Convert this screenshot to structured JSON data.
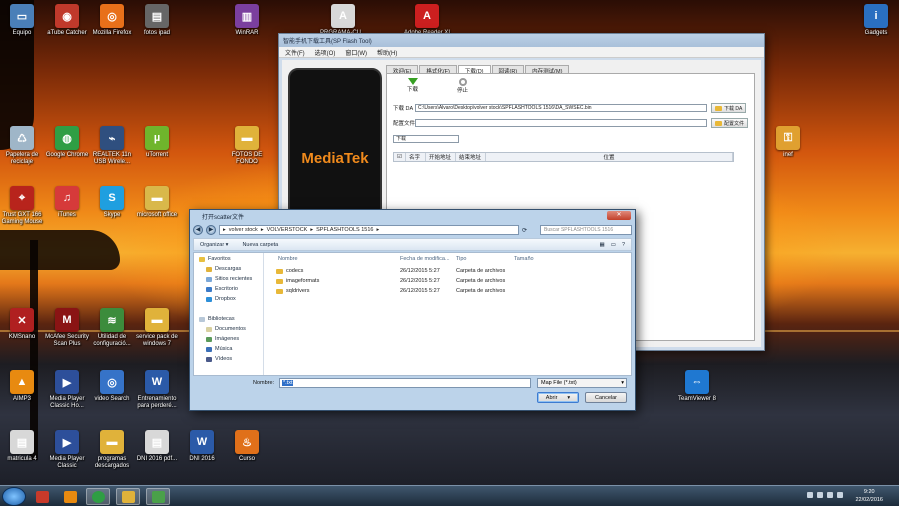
{
  "desktop": {
    "icons": [
      {
        "label": "Equipo",
        "icon": "computer-icon",
        "color": "#4a7fb8",
        "glyph": "▭"
      },
      {
        "label": "aTube Catcher",
        "icon": "atube-catcher-icon",
        "color": "#c0392b",
        "glyph": "◉"
      },
      {
        "label": "Mozilla Firefox",
        "icon": "firefox-icon",
        "color": "#e8701a",
        "glyph": "◎"
      },
      {
        "label": "fotos ipad",
        "icon": "folder-file-icon",
        "color": "#666666",
        "glyph": "▤"
      },
      {
        "label": "WinRAR",
        "icon": "winrar-icon",
        "color": "#7b3f9e",
        "glyph": "▥"
      },
      {
        "label": "PRGRAMA-CU...",
        "icon": "pdf-icon",
        "color": "#d8d8d8",
        "glyph": "A"
      },
      {
        "label": "Adobe Reader XI",
        "icon": "adobe-reader-icon",
        "color": "#cc1f1f",
        "glyph": "A"
      },
      {
        "label": "Papelera de\nreciclaje",
        "icon": "recycle-bin-icon",
        "color": "#9fb6c8",
        "glyph": "♺"
      },
      {
        "label": "Google Chrome",
        "icon": "chrome-icon",
        "color": "#2f9e44",
        "glyph": "◍"
      },
      {
        "label": "REALTEK 11n\nUSB Wirele...",
        "icon": "wireless-icon",
        "color": "#2f4f7f",
        "glyph": "⌁"
      },
      {
        "label": "uTorrent",
        "icon": "utorrent-icon",
        "color": "#6fb52c",
        "glyph": "µ"
      },
      {
        "label": "FOTOS DE\nFONDO",
        "icon": "folder-icon",
        "color": "#e0b23a",
        "glyph": "▬"
      },
      {
        "label": "Trust GXT 166\nGaming Mouse",
        "icon": "mouse-icon",
        "color": "#b8241c",
        "glyph": "⌖"
      },
      {
        "label": "iTunes",
        "icon": "itunes-icon",
        "color": "#d63a3a",
        "glyph": "♫"
      },
      {
        "label": "Skype",
        "icon": "skype-icon",
        "color": "#1f9fe0",
        "glyph": "S"
      },
      {
        "label": "microsoft office",
        "icon": "office-folder-icon",
        "color": "#d9b84a",
        "glyph": "▬"
      },
      {
        "label": "KMSnano",
        "icon": "kmsnano-icon",
        "color": "#b02020",
        "glyph": "✕"
      },
      {
        "label": "McAfee Security\nScan Plus",
        "icon": "mcafee-icon",
        "color": "#8a1414",
        "glyph": "M"
      },
      {
        "label": "Utilidad de\nconfiguració...",
        "icon": "config-utility-icon",
        "color": "#3c8c3c",
        "glyph": "≋"
      },
      {
        "label": "service pack de\nwindows 7",
        "icon": "service-pack-folder-icon",
        "color": "#e0b23a",
        "glyph": "▬"
      },
      {
        "label": "AIMP3",
        "icon": "aimp-icon",
        "color": "#e88a10",
        "glyph": "▲"
      },
      {
        "label": "Media Player\nClassic Ho...",
        "icon": "media-player-icon",
        "color": "#2d4f9a",
        "glyph": "▶"
      },
      {
        "label": "video Search",
        "icon": "video-search-icon",
        "color": "#3673c8",
        "glyph": "◎"
      },
      {
        "label": "Entrenamiento\npara perderé...",
        "icon": "word-doc-icon",
        "color": "#2b5aa8",
        "glyph": "W"
      },
      {
        "label": "matricula 4",
        "icon": "pdf-file-icon",
        "color": "#d8d8d8",
        "glyph": "▤"
      },
      {
        "label": "Media Player\nClassic",
        "icon": "media-player-classic-icon",
        "color": "#2d4f9a",
        "glyph": "▶"
      },
      {
        "label": "programas\ndescargados",
        "icon": "downloads-folder-icon",
        "color": "#e0b23a",
        "glyph": "▬"
      },
      {
        "label": "DNI 2016 pdf...",
        "icon": "pdf-doc-icon",
        "color": "#d8d8d8",
        "glyph": "▤"
      },
      {
        "label": "DNI 2016",
        "icon": "word-file-icon",
        "color": "#2b5aa8",
        "glyph": "W"
      },
      {
        "label": "Curso",
        "icon": "flame-icon",
        "color": "#e0701a",
        "glyph": "♨"
      },
      {
        "label": "Gadgets",
        "icon": "info-icon",
        "color": "#2a6fc0",
        "glyph": "i"
      },
      {
        "label": "inef",
        "icon": "key-icon",
        "color": "#e0a030",
        "glyph": "⚿"
      },
      {
        "label": "TeamViewer 8",
        "icon": "teamviewer-icon",
        "color": "#1f78d1",
        "glyph": "⇔"
      }
    ]
  },
  "flash_tool": {
    "title": "智能手机下载工具(SP Flash Tool)",
    "menu": [
      "文件(F)",
      "选项(O)",
      "窗口(W)",
      "帮助(H)"
    ],
    "tabs": [
      "欢迎(E)",
      "格式化(F)",
      "下载(D)",
      "回读(R)",
      "内存测试(M)"
    ],
    "active_tab": "下载(D)",
    "download_label": "下载",
    "stop_label": "停止",
    "da_label": "下载 DA",
    "da_path": "C:\\Users\\Alvaro\\Desktop\\volver stock\\SPFLASHTOOLS 1516\\DA_SWSEC.bin",
    "da_button": "下载 DA",
    "scatter_label": "配置文件",
    "scatter_path": "",
    "scatter_button": "配置文件",
    "mode": "下载",
    "grid_columns": [
      "名字",
      "开始地址",
      "结束地址",
      "位置"
    ],
    "phone_brand": "MediaTek"
  },
  "open_dialog": {
    "title": "打开scatter文件",
    "breadcrumb": [
      "volver stock",
      "VOLVERSTOCK",
      "SPFLASHTOOLS 1516"
    ],
    "search_placeholder": "Buscar SPFLASHTOOLS 1516",
    "organize": "Organizar ▾",
    "new_folder": "Nueva carpeta",
    "nav": {
      "favorites_header": "Favoritos",
      "favorites": [
        "Descargas",
        "Sitios recientes",
        "Escritorio",
        "Dropbox"
      ],
      "libraries_header": "Bibliotecas",
      "libraries": [
        "Documentos",
        "Imágenes",
        "Música",
        "Vídeos"
      ]
    },
    "columns": [
      "Nombre",
      "Fecha de modifica...",
      "Tipo",
      "Tamaño"
    ],
    "files": [
      {
        "name": "codecs",
        "date": "26/12/2015 5:27",
        "type": "Carpeta de archivos"
      },
      {
        "name": "imageformats",
        "date": "26/12/2015 5:27",
        "type": "Carpeta de archivos"
      },
      {
        "name": "sqldrivers",
        "date": "26/12/2015 5:27",
        "type": "Carpeta de archivos"
      }
    ],
    "filename_label": "Nombre:",
    "filename_value": "*.txt",
    "filter": "Map File (*.txt)",
    "open_button": "Abrir",
    "cancel_button": "Cancelar"
  },
  "taskbar": {
    "time": "9:20",
    "date": "22/02/2016"
  },
  "colors": {
    "dialog_chrome": "#bcd3ea",
    "taskbar": "#2b3d50"
  }
}
